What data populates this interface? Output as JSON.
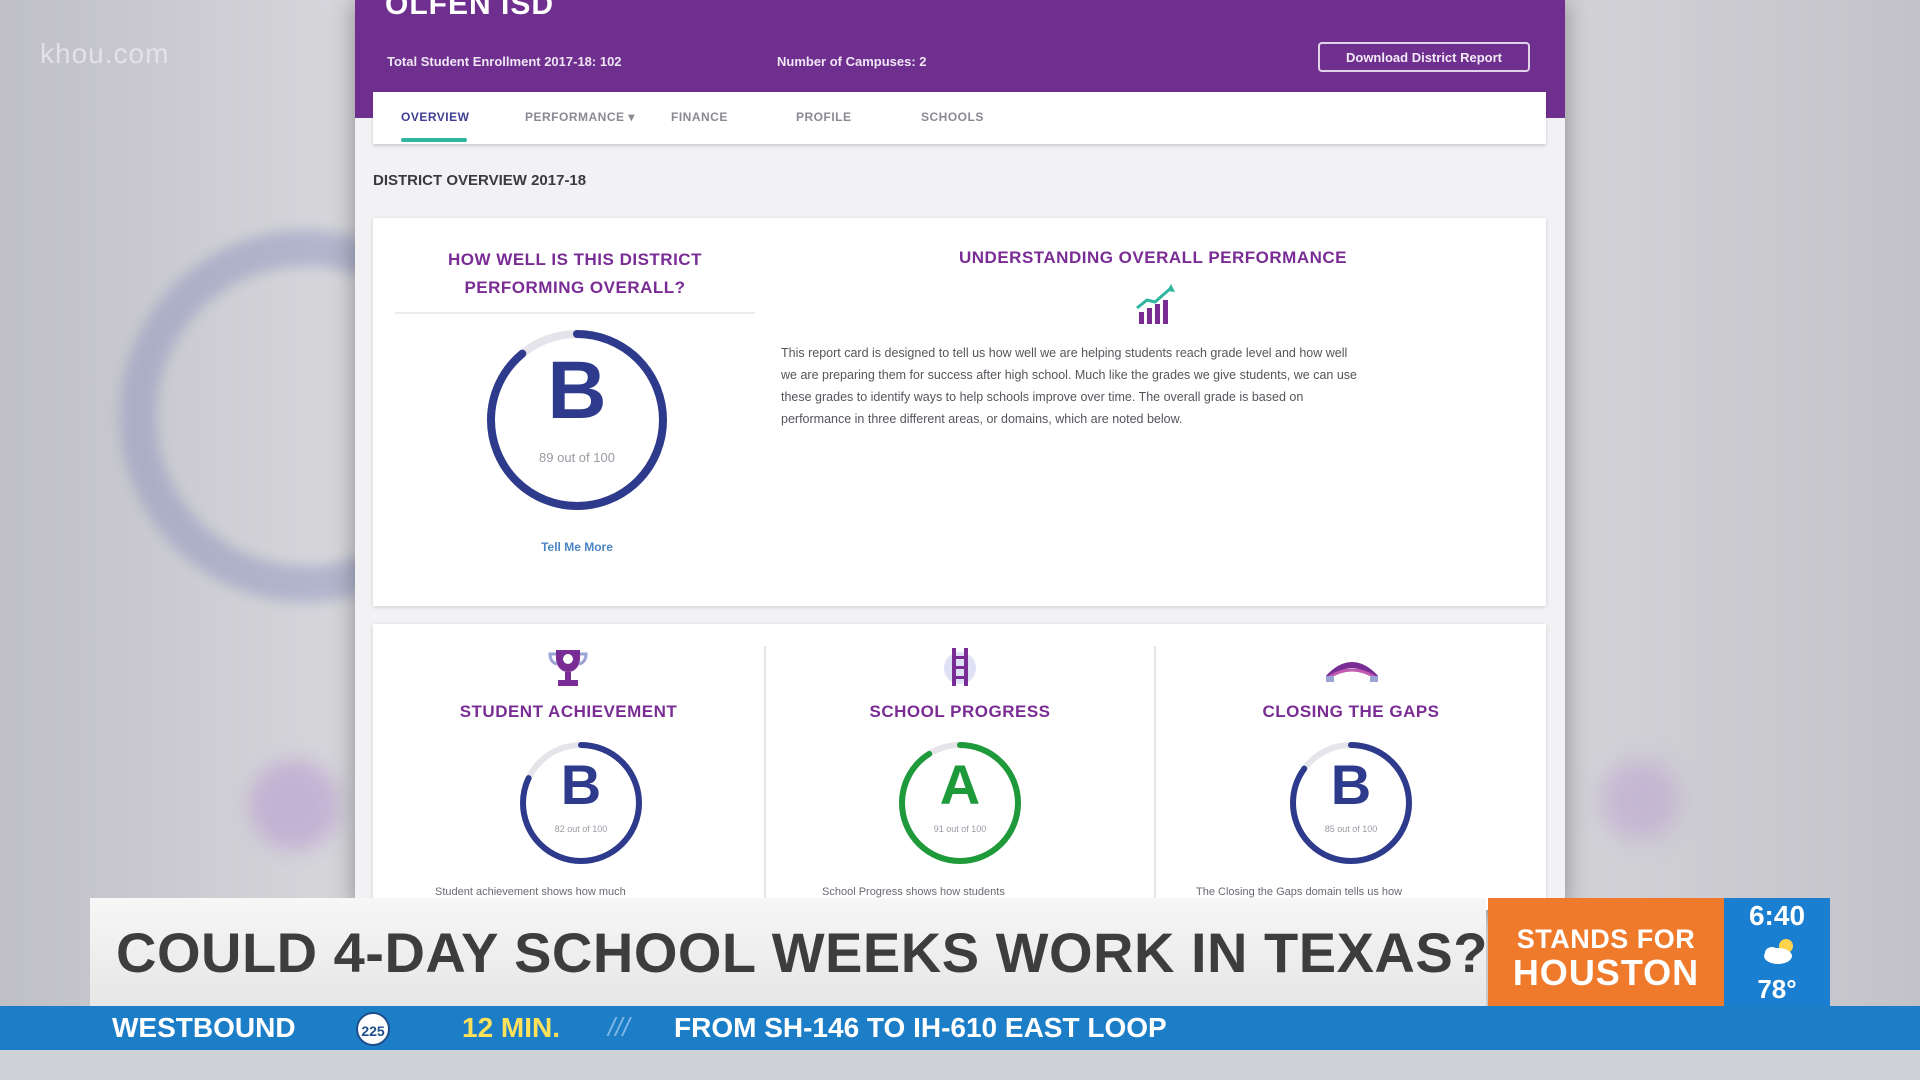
{
  "watermark": "khou.com",
  "district": {
    "name": "OLFEN ISD",
    "enrollment": "Total Student Enrollment 2017-18: 102",
    "campuses": "Number of Campuses: 2",
    "download_label": "Download District Report"
  },
  "tabs": [
    {
      "label": "OVERVIEW"
    },
    {
      "label": "PERFORMANCE ▾"
    },
    {
      "label": "FINANCE"
    },
    {
      "label": "PROFILE"
    },
    {
      "label": "SCHOOLS"
    }
  ],
  "overview": {
    "section_title": "DISTRICT OVERVIEW 2017-18",
    "question_line1": "HOW WELL IS THIS DISTRICT",
    "question_line2": "PERFORMING OVERALL?",
    "overall_grade": "B",
    "overall_score_text": "89 out of 100",
    "overall_score": 89,
    "tell_me_more": "Tell Me More",
    "understanding_title": "UNDERSTANDING OVERALL PERFORMANCE",
    "understanding_lines": [
      "This report card is designed to tell us how well we are helping students reach grade level and how well",
      "we are preparing them for success after high school. Much like the grades we give students, we can use",
      "these grades to identify ways to help schools improve over time. The overall grade is based on",
      "performance in three different areas, or domains, which are noted below."
    ]
  },
  "domains": [
    {
      "title": "STUDENT ACHIEVEMENT",
      "grade": "B",
      "score_text": "82 out of 100",
      "score": 82,
      "color": "#2e3a8c",
      "icon": "trophy-icon",
      "desc": "Student achievement shows how much"
    },
    {
      "title": "SCHOOL PROGRESS",
      "grade": "A",
      "score_text": "91 out of 100",
      "score": 91,
      "color": "#1f9a3a",
      "icon": "ladder-icon",
      "desc": "School Progress shows how students"
    },
    {
      "title": "CLOSING THE GAPS",
      "grade": "B",
      "score_text": "85 out of 100",
      "score": 85,
      "color": "#2e3a8c",
      "icon": "bridge-icon",
      "desc": "The Closing the Gaps domain tells us how"
    }
  ],
  "colors": {
    "header_purple": "#6f2f8e",
    "ring_blue": "#2e3a8c",
    "ring_green": "#1f9a3a",
    "tab_underline": "#2fb5a0",
    "brand_orange": "#ef7a2b",
    "traffic_blue": "#1d7ec8"
  },
  "ticker": {
    "headline": "COULD 4-DAY SCHOOL WEEKS WORK IN TEXAS?",
    "brand_line1": "STANDS FOR",
    "brand_line2": "HOUSTON",
    "time": "6:40",
    "weather_icon": "partly-cloudy-icon",
    "temp": "78°"
  },
  "traffic": {
    "direction": "WESTBOUND",
    "highway": "225",
    "minutes": "12 MIN.",
    "separator": "///",
    "route": "FROM SH-146 TO IH-610 EAST LOOP"
  }
}
